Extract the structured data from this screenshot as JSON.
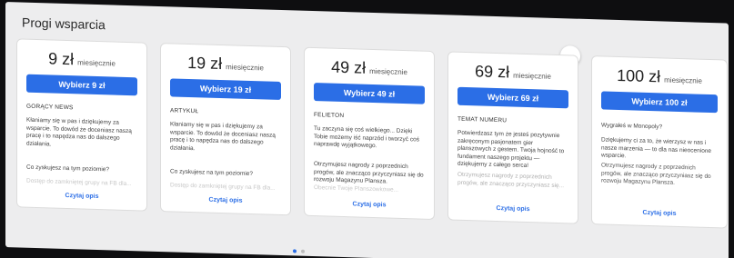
{
  "section_title": "Progi wsparcia",
  "colors": {
    "accent": "#2b6ee6"
  },
  "nav": {
    "prev_icon": "arrow-left-icon",
    "next_icon": "arrow-right-icon"
  },
  "cards": [
    {
      "amount": "9 zł",
      "period": "miesięcznie",
      "button": "Wybierz 9 zł",
      "tier": "GORĄCY NEWS",
      "description": "Kłaniamy się w pas i dziękujemy za wsparcie. To dowód że doceniasz naszą pracę i to napędza nas do dalszego działania.",
      "question": "Co zyskujesz na tym poziomie?",
      "faded": "Dostęp do zamkniętej grupy na FB dla...",
      "read_more": "Czytaj opis"
    },
    {
      "amount": "19 zł",
      "period": "miesięcznie",
      "button": "Wybierz 19 zł",
      "tier": "ARTYKUŁ",
      "description": "Kłaniamy się w pas i dziękujemy za wsparcie. To dowód że doceniasz naszą pracę i to napędza nas do dalszego działania.",
      "question": "Co zyskujesz na tym poziomie?",
      "faded": "Dostęp do zamkniętej grupy na FB dla...",
      "read_more": "Czytaj opis"
    },
    {
      "amount": "49 zł",
      "period": "miesięcznie",
      "button": "Wybierz 49 zł",
      "tier": "FELIETON",
      "description": "Tu zaczyna się coś wielkiego... Dzięki Tobie możemy iść naprzód i tworzyć coś naprawdę wyjątkowego.",
      "question": "Otrzymujesz nagrody z poprzednich progów, ale znacząco przyczyniasz się do rozwoju Magazynu Plansza.",
      "faded": "Obecnie Twoje Planszowkowe...",
      "read_more": "Czytaj opis"
    },
    {
      "amount": "69 zł",
      "period": "miesięcznie",
      "button": "Wybierz 69 zł",
      "tier": "TEMAT NUMERU",
      "description": "Potwierdzasz tym że jesteś pozytywnie zakręconym pasjonatem gier planszowych z gestem. Twoja hojność to fundament naszego projektu — dziękujemy z całego serca!",
      "question": "Otrzymujesz nagrody z poprzednich progów, ale znacząco przyczyniasz się...",
      "faded": "",
      "read_more": "Czytaj opis"
    },
    {
      "amount": "100 zł",
      "period": "miesięcznie",
      "button": "Wybierz 100 zł",
      "tier": "",
      "description": "Wygrałeś w Monopoly?",
      "question": "Dziękujemy ci za to, że wierzysz w nas i nasze marzenia — to dla nas nieocenione wsparcie.",
      "faded": "Otrzymujesz nagrody z poprzednich progów, ale znacząco przyczyniasz się do rozwoju Magazynu Plansza.",
      "read_more": "Czytaj opis"
    }
  ]
}
